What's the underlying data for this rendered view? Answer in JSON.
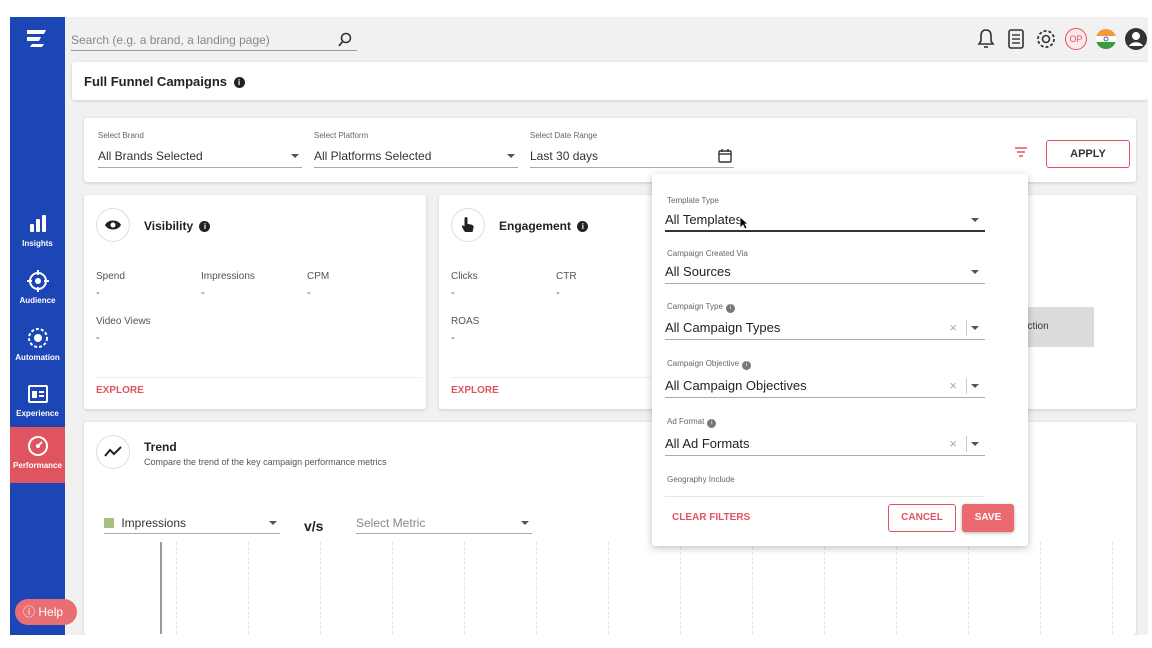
{
  "search": {
    "placeholder": "Search (e.g. a brand, a landing page)"
  },
  "header": {
    "title": "Full Funnel Campaigns"
  },
  "sidebar": {
    "items": [
      {
        "label": "Insights"
      },
      {
        "label": "Audience"
      },
      {
        "label": "Automation"
      },
      {
        "label": "Experience"
      },
      {
        "label": "Performance"
      }
    ],
    "help_label": "Help"
  },
  "top_icons": {
    "profile_initials": "OP"
  },
  "filters": {
    "brand": {
      "label": "Select Brand",
      "value": "All Brands Selected"
    },
    "platform": {
      "label": "Select Platform",
      "value": "All Platforms Selected"
    },
    "date": {
      "label": "Select Date Range",
      "value": "Last 30 days"
    },
    "apply_label": "APPLY"
  },
  "visibility": {
    "title": "Visibility",
    "metrics": [
      {
        "label": "Spend",
        "value": "-"
      },
      {
        "label": "Impressions",
        "value": "-"
      },
      {
        "label": "CPM",
        "value": "-"
      },
      {
        "label": "Video Views",
        "value": "-"
      }
    ],
    "explore_label": "EXPLORE"
  },
  "engagement": {
    "title": "Engagement",
    "metrics": [
      {
        "label": "Clicks",
        "value": "-"
      },
      {
        "label": "CTR",
        "value": "-"
      },
      {
        "label": "ROAS",
        "value": "-"
      }
    ],
    "explore_label": "EXPLORE"
  },
  "right_card": {
    "button_label": "ection"
  },
  "trend": {
    "title": "Trend",
    "subtitle": "Compare the trend of the key campaign performance metrics",
    "metric1": "Impressions",
    "vs": "v/s",
    "metric2_placeholder": "Select Metric"
  },
  "panel": {
    "template_type": {
      "label": "Template Type",
      "value": "All Templates"
    },
    "created_via": {
      "label": "Campaign Created Via",
      "value": "All Sources"
    },
    "campaign_type": {
      "label": "Campaign Type",
      "value": "All Campaign Types"
    },
    "campaign_objective": {
      "label": "Campaign Objective",
      "value": "All Campaign Objectives"
    },
    "ad_format": {
      "label": "Ad Format",
      "value": "All Ad Formats"
    },
    "geography": {
      "label": "Geography Include"
    },
    "clear_label": "CLEAR FILTERS",
    "cancel_label": "CANCEL",
    "save_label": "SAVE",
    "clear_glyph": "×"
  },
  "colors": {
    "sidebar": "#1c45b5",
    "accent": "#e0545f",
    "save": "#ea6a70"
  }
}
